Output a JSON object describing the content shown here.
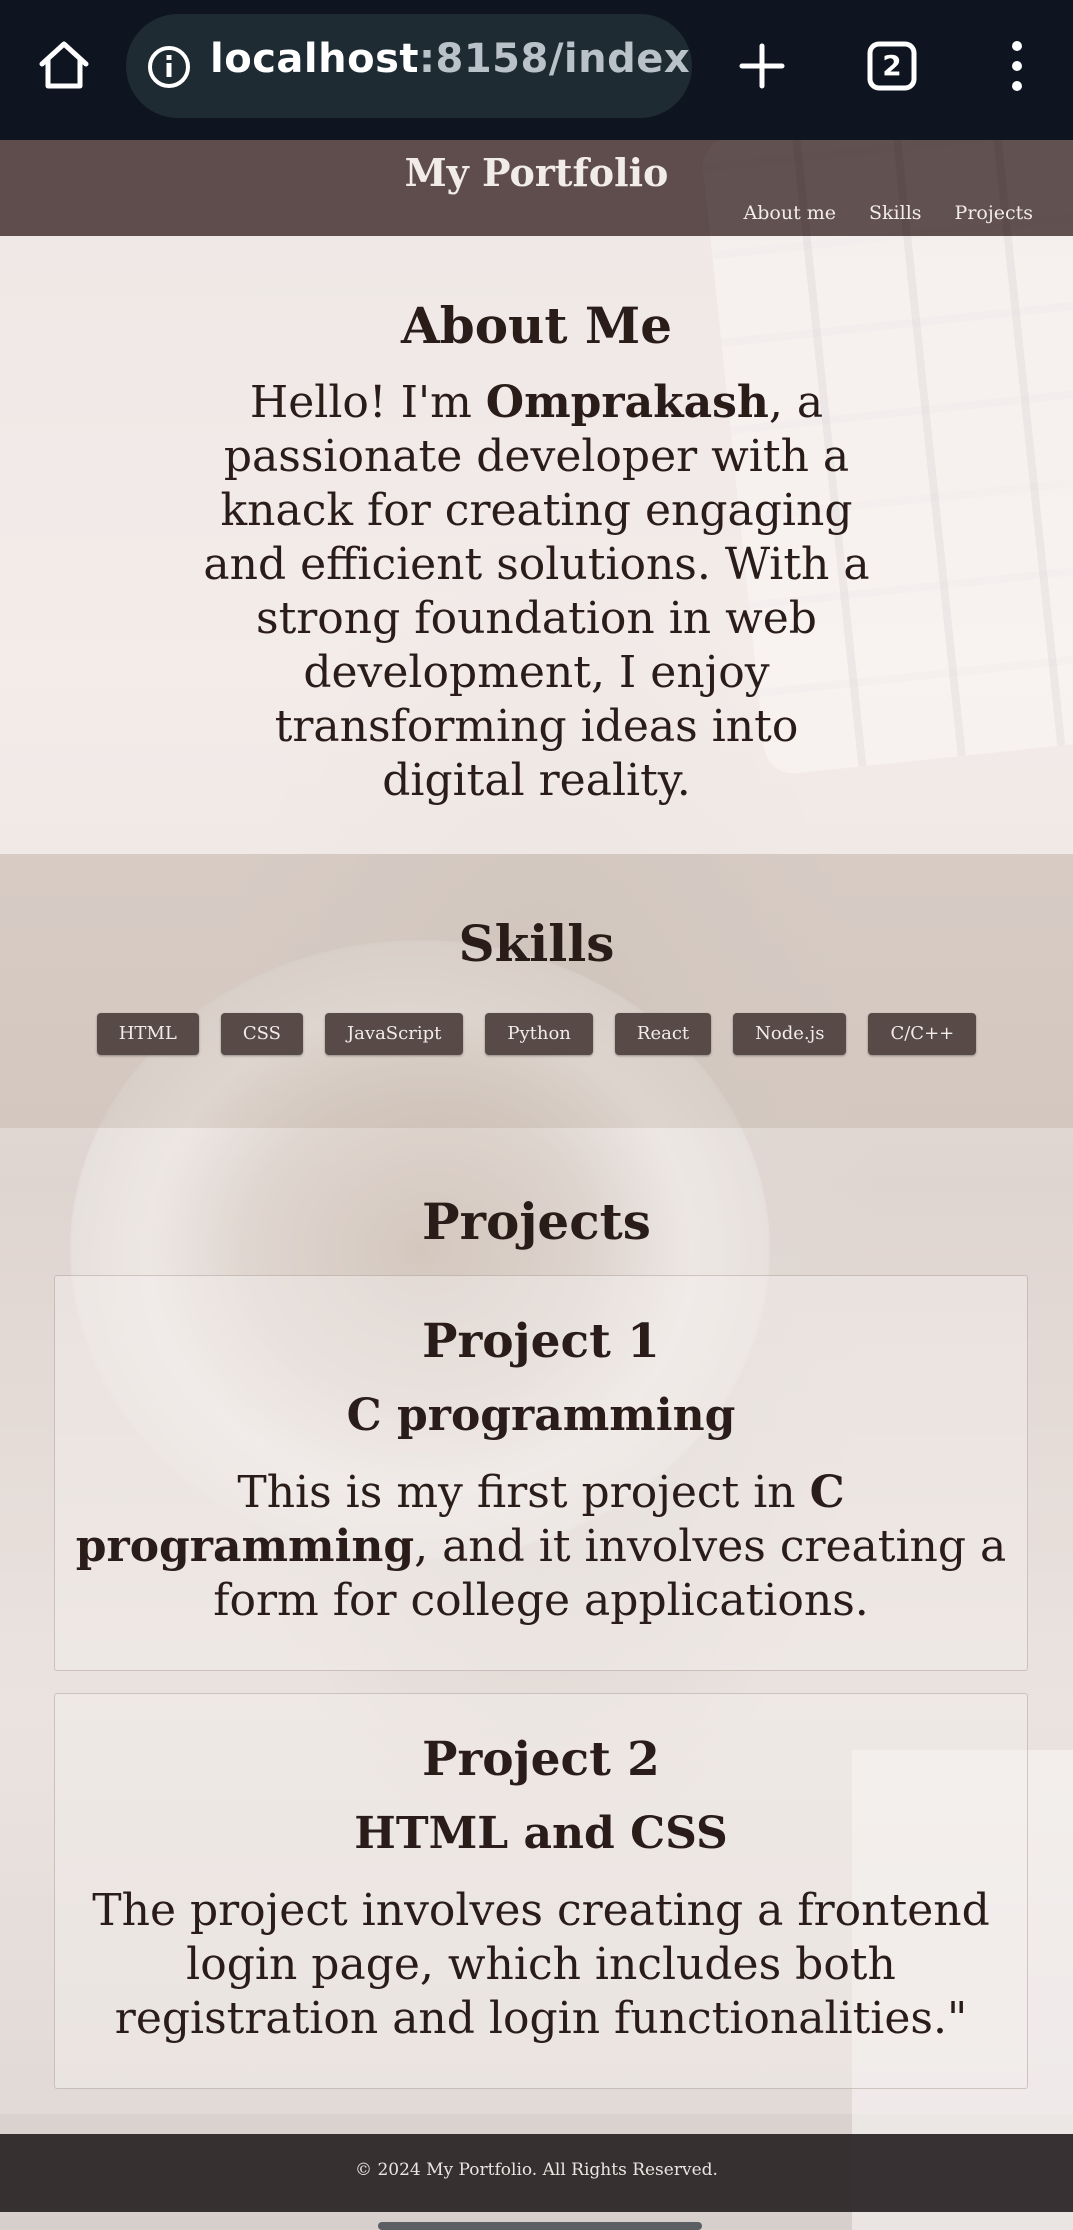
{
  "browser": {
    "url_host": "localhost",
    "url_rest": ":8158/index",
    "tab_count": "2",
    "icons": [
      "home-icon",
      "info-icon",
      "plus-icon",
      "tabs-icon",
      "more-vert-icon"
    ]
  },
  "header": {
    "title": "My Portfolio",
    "nav": [
      "About me",
      "Skills",
      "Projects"
    ]
  },
  "about": {
    "heading": "About Me",
    "text_before": "Hello! I'm ",
    "name": "Omprakash",
    "text_after": ", a passionate developer with a knack for creating engaging and efficient solutions. With a strong foundation in web development, I enjoy transforming ideas into digital reality."
  },
  "skills": {
    "heading": "Skills",
    "items": [
      "HTML",
      "CSS",
      "JavaScript",
      "Python",
      "React",
      "Node.js",
      "C/C++"
    ]
  },
  "projects": {
    "heading": "Projects",
    "items": [
      {
        "title": "Project 1",
        "subtitle": "C programming",
        "desc_before": "This is my first project in ",
        "desc_bold": "C programming",
        "desc_after": ", and it involves creating a form for college applications."
      },
      {
        "title": "Project 2",
        "subtitle": "HTML and CSS",
        "desc": "The project involves creating a frontend login page, which includes both registration and login functionalities.\""
      }
    ]
  },
  "footer": {
    "text": "© 2024 My Portfolio. All Rights Reserved."
  }
}
